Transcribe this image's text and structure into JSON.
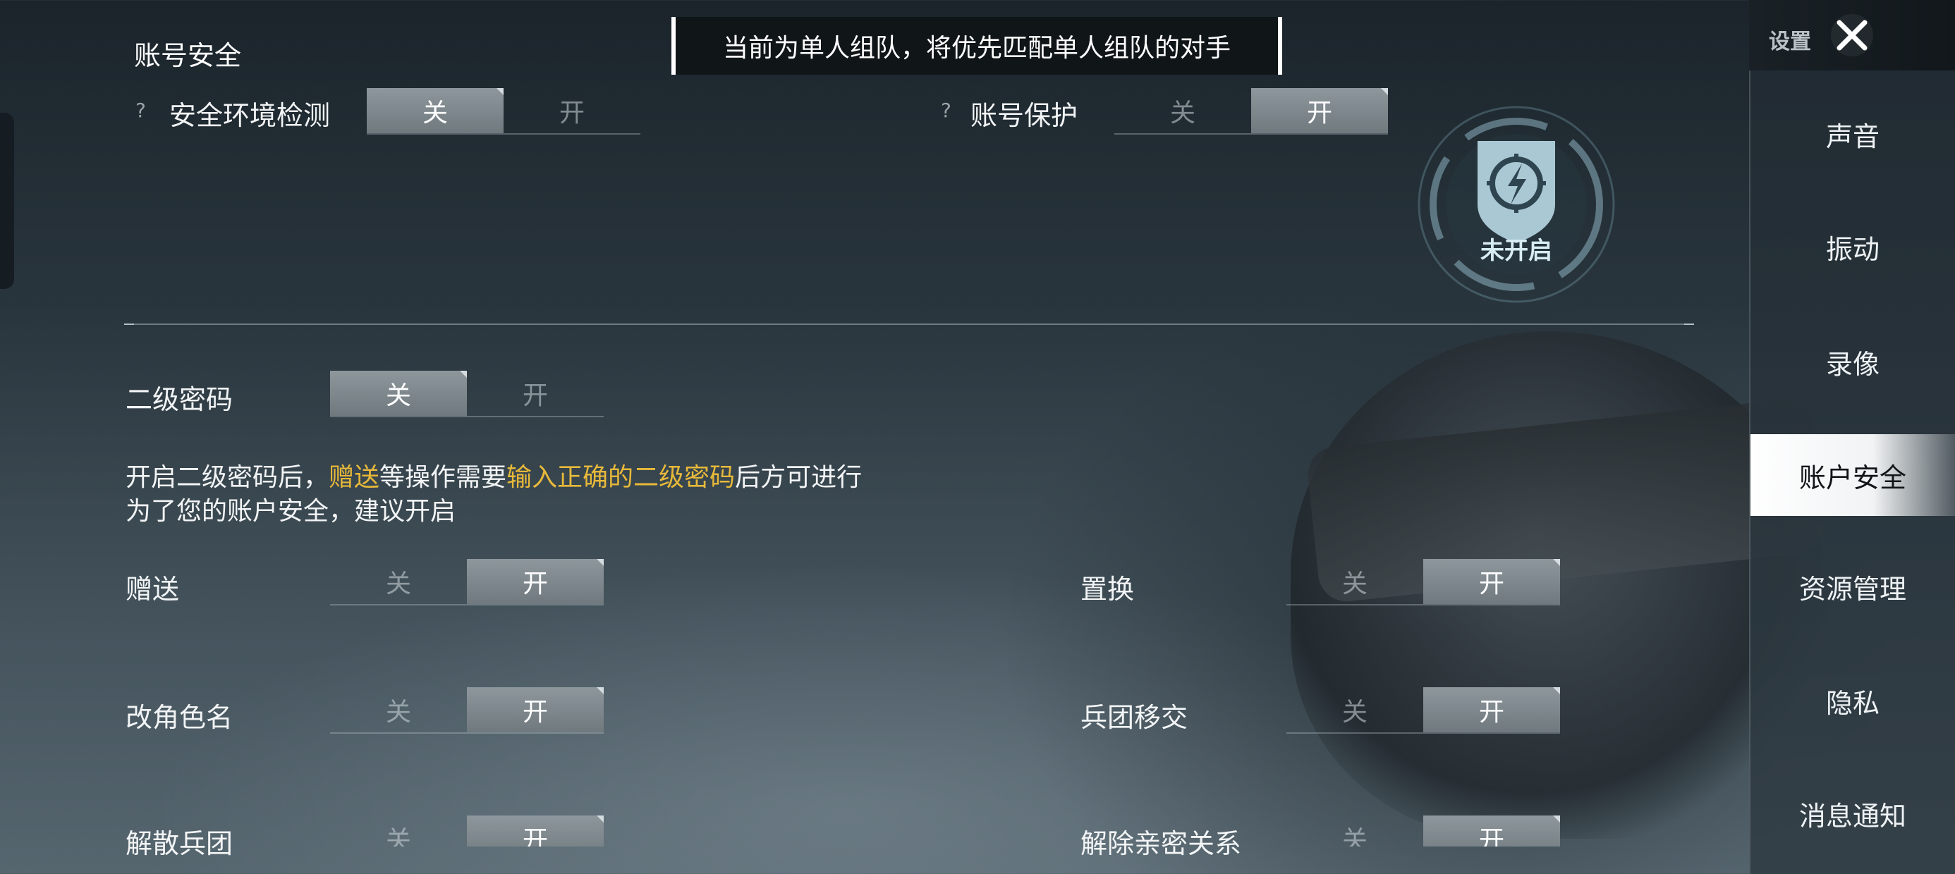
{
  "toast": {
    "message": "当前为单人组队，将优先匹配单人组队的对手"
  },
  "section": {
    "title": "账号安全"
  },
  "top_settings": [
    {
      "help": "?",
      "label": "安全环境检测",
      "off": "关",
      "on": "开",
      "state": "off"
    },
    {
      "help": "?",
      "label": "账号保护",
      "off": "关",
      "on": "开",
      "state": "on"
    }
  ],
  "protection_badge": {
    "status": "未开启",
    "icon": "shield-lightning-icon"
  },
  "secondary_password": {
    "label": "二级密码",
    "off": "关",
    "on": "开",
    "state": "off",
    "desc_part1": "开启二级密码后，",
    "desc_hl1": "赠送",
    "desc_part2": "等操作需要",
    "desc_hl2": "输入正确的二级密码",
    "desc_part3": "后方可进行",
    "desc_line2": "为了您的账户安全，建议开启",
    "highlight_color": "#e7b93a"
  },
  "operations": [
    {
      "label": "赠送",
      "off": "关",
      "on": "开",
      "state": "on"
    },
    {
      "label": "置换",
      "off": "关",
      "on": "开",
      "state": "on"
    },
    {
      "label": "改角色名",
      "off": "关",
      "on": "开",
      "state": "on"
    },
    {
      "label": "兵团移交",
      "off": "关",
      "on": "开",
      "state": "on"
    },
    {
      "label": "解散兵团",
      "off": "关",
      "on": "开",
      "state": "on"
    },
    {
      "label": "解除亲密关系",
      "off": "关",
      "on": "开",
      "state": "on"
    }
  ],
  "sidebar": {
    "title": "设置",
    "close_icon": "close-x-icon",
    "items": [
      {
        "label": "声音"
      },
      {
        "label": "振动"
      },
      {
        "label": "录像"
      },
      {
        "label": "账户安全",
        "active": true
      },
      {
        "label": "资源管理"
      },
      {
        "label": "隐私"
      },
      {
        "label": "消息通知"
      }
    ]
  }
}
